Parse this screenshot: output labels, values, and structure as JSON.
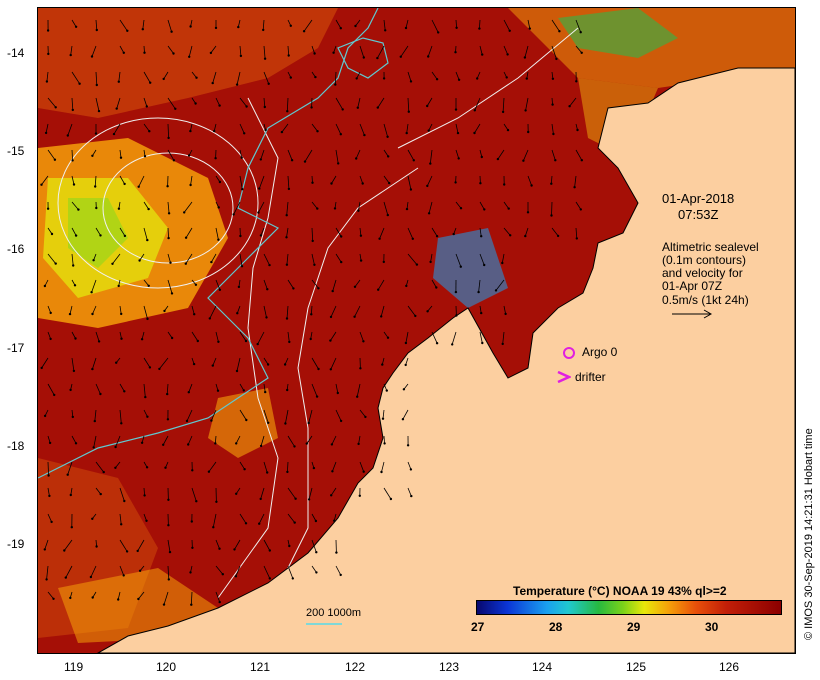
{
  "map": {
    "x_ticks": [
      "119",
      "120",
      "121",
      "122",
      "123",
      "124",
      "125",
      "126"
    ],
    "y_ticks": [
      "-14",
      "-15",
      "-16",
      "-17",
      "-18",
      "-19"
    ],
    "x_range_deg_E": [
      118.6,
      126.7
    ],
    "y_range_deg": [
      -13.5,
      -20.1
    ]
  },
  "annotations": {
    "date": "01-Apr-2018",
    "time": "07:53Z",
    "altimetry_line1": "Altimetric sealevel",
    "altimetry_line2": "(0.1m contours)",
    "altimetry_line3": "and velocity for",
    "altimetry_line4": "01-Apr 07Z",
    "altimetry_line5": "0.5m/s (1kt 24h)",
    "argo_label": "Argo 0",
    "drifter_label": "drifter",
    "scale_label": "200  1000m",
    "credit": "© IMOS 30-Sep-2019 14:21:31 Hobart time"
  },
  "colorbar": {
    "title": "Temperature (°C) NOAA 19 43% ql>=2",
    "ticks": [
      "27",
      "28",
      "29",
      "30"
    ]
  },
  "colors": {
    "sea_warm": "#a50f06",
    "land": "#fccfa0",
    "argo_marker": "#e020e0",
    "contour": "#f0f0f0",
    "isobath": "#60c8d0"
  }
}
